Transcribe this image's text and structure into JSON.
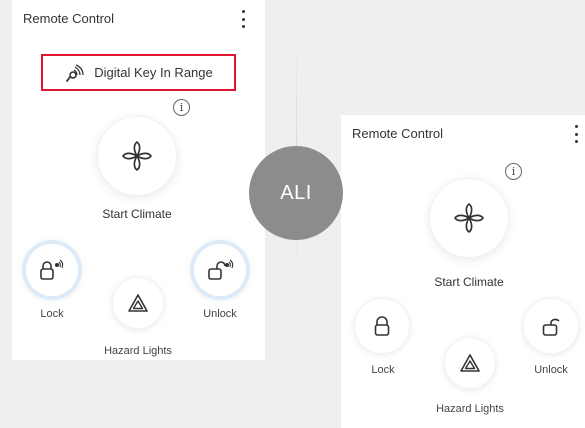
{
  "left_panel": {
    "title": "Remote Control",
    "digital_key_label": "Digital Key In Range",
    "info_glyph": "i",
    "start_climate_label": "Start Climate",
    "lock_label": "Lock",
    "unlock_label": "Unlock",
    "hazard_label": "Hazard Lights"
  },
  "badge": {
    "text": "ALI"
  },
  "right_panel": {
    "title": "Remote Control",
    "info_glyph": "i",
    "start_climate_label": "Start Climate",
    "lock_label": "Lock",
    "unlock_label": "Unlock",
    "hazard_label": "Hazard Lights"
  },
  "colors": {
    "highlight_border": "#e0142e",
    "ring_blue": "#dcebf7",
    "badge_gray": "#8c8c8c",
    "background": "#efefef"
  },
  "icons": [
    "kebab-menu-icon",
    "digital-key-signal-icon",
    "info-icon",
    "fan-icon",
    "lock-icon",
    "unlock-icon",
    "hazard-icon",
    "signal-waves-icon"
  ]
}
